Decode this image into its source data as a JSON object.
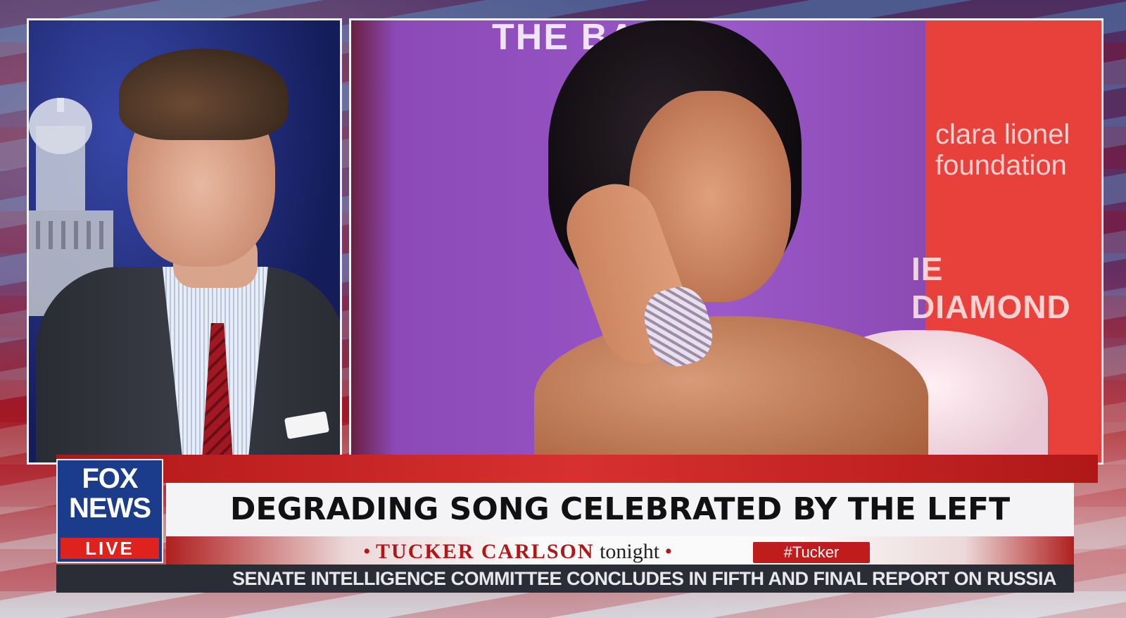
{
  "broadcast": {
    "network_logo": {
      "line1": "FOX",
      "line2": "NEWS",
      "line3": "LIVE"
    },
    "headline": "DEGRADING SONG CELEBRATED BY THE LEFT",
    "show": {
      "dot_left": "•",
      "host_name": "TUCKER CARLSON",
      "show_word": "tonight",
      "dot_right": "•"
    },
    "hashtag": "#Tucker",
    "ticker": "SENATE INTELLIGENCE COMMITTEE CONCLUDES IN FIFTH AND FINAL REPORT ON RUSSIA"
  },
  "right_photo": {
    "wall_text": "THE    BALL",
    "banner_line1": "clara lionel",
    "banner_line2": "foundation",
    "banner_line3": "IE DIAMOND B"
  },
  "colors": {
    "fox_blue": "#1a3c8a",
    "fox_red": "#e0221e",
    "show_red": "#b01818",
    "ticker_bg": "#2a2c36"
  }
}
